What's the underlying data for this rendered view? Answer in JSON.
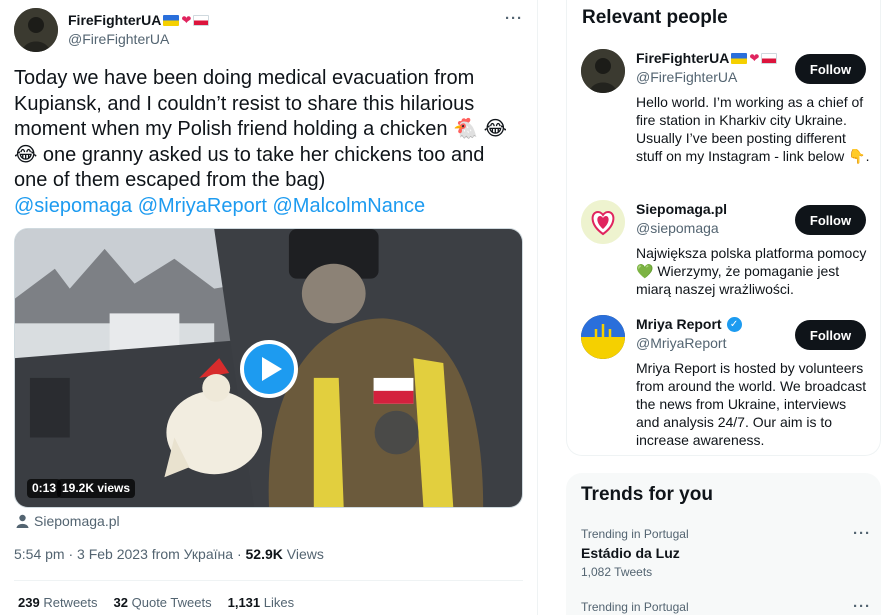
{
  "post": {
    "author_name": "FireFighterUA",
    "author_handle": "@FireFighterUA",
    "text": "Today we have been doing medical evacuation from Kupiansk, and I couldn’t resist to share this hilarious moment when my Polish friend holding a chicken 🐔 😂😂 one granny asked us to take her chickens too and one of them escaped from the bag)",
    "mentions": [
      "@siepomaga",
      "@MriyaReport",
      "@MalcolmNance"
    ],
    "video": {
      "duration": "0:13",
      "views": "19.2K views"
    },
    "source": "Siepomaga.pl",
    "time": "5:54 pm",
    "date": "3 Feb 2023",
    "from_label": "from Україна",
    "view_count": "52.9K",
    "views_label": "Views",
    "retweets": {
      "count": "239",
      "label": "Retweets"
    },
    "quotes": {
      "count": "32",
      "label": "Quote Tweets"
    },
    "likes": {
      "count": "1,131",
      "label": "Likes"
    }
  },
  "relevant_people": {
    "title": "Relevant people",
    "people": [
      {
        "name": "FireFighterUA",
        "handle": "@FireFighterUA",
        "bio": "Hello world. I’m working as a chief of fire station in Kharkiv city Ukraine. Usually I’ve been posting different stuff on my Instagram - link below 👇.",
        "follow_label": "Follow"
      },
      {
        "name": "Siepomaga.pl",
        "handle": "@siepomaga",
        "bio": "Największa polska platforma pomocy 💚 Wierzymy, że pomaganie jest miarą naszej wrażliwości.",
        "follow_label": "Follow"
      },
      {
        "name": "Mriya Report",
        "handle": "@MriyaReport",
        "bio": "Mriya Report is hosted by volunteers from around the world. We broadcast the news from Ukraine, interviews and analysis 24/7. Our aim is to increase awareness.",
        "follow_label": "Follow",
        "verified": true
      }
    ]
  },
  "trends": {
    "title": "Trends for you",
    "items": [
      {
        "category": "Trending in Portugal",
        "name": "Estádio da Luz",
        "count": "1,082 Tweets"
      },
      {
        "category": "Trending in Portugal",
        "name": "",
        "count": ""
      }
    ]
  },
  "colors": {
    "accent": "#1d9bf0",
    "text": "#0f1419",
    "muted": "#536471",
    "button": "#0f1419"
  },
  "icons": [
    "more-icon",
    "play-icon",
    "person-icon",
    "verified-icon",
    "flag-ukraine-icon",
    "flag-poland-icon",
    "heart-fire-icon"
  ]
}
